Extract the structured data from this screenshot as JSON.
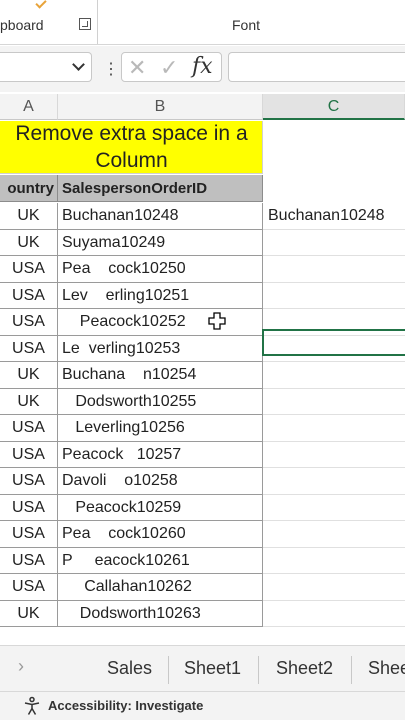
{
  "ribbon": {
    "clipboard_label": "pboard",
    "font_label": "Font"
  },
  "formula_bar": {
    "name_box_value": "",
    "formula_value": ""
  },
  "columns": [
    "A",
    "B",
    "C"
  ],
  "title": {
    "line1": "Remove extra space in a",
    "line2": "Column"
  },
  "table_headers": {
    "country": "ountry",
    "order_id": "SalespersonOrderID"
  },
  "rows": [
    {
      "country": "UK",
      "id": "Buchanan10248",
      "result": "Buchanan10248"
    },
    {
      "country": "UK",
      "id": "Suyama10249",
      "result": ""
    },
    {
      "country": "USA",
      "id": "Pea    cock10250",
      "result": ""
    },
    {
      "country": "USA",
      "id": "Lev    erling10251",
      "result": ""
    },
    {
      "country": "USA",
      "id": "    Peacock10252",
      "result": ""
    },
    {
      "country": "USA",
      "id": "Le  verling10253",
      "result": ""
    },
    {
      "country": "UK",
      "id": "Buchana    n10254",
      "result": ""
    },
    {
      "country": "UK",
      "id": "   Dodsworth10255",
      "result": ""
    },
    {
      "country": "USA",
      "id": "   Leverling10256",
      "result": ""
    },
    {
      "country": "USA",
      "id": "Peacock   10257",
      "result": ""
    },
    {
      "country": "USA",
      "id": "Davoli    o10258",
      "result": ""
    },
    {
      "country": "USA",
      "id": "   Peacock10259",
      "result": ""
    },
    {
      "country": "USA",
      "id": "Pea    cock10260",
      "result": ""
    },
    {
      "country": "USA",
      "id": "P     eacock10261",
      "result": ""
    },
    {
      "country": "USA",
      "id": "     Callahan10262",
      "result": ""
    },
    {
      "country": "UK",
      "id": "    Dodsworth10263",
      "result": ""
    }
  ],
  "sheet_tabs": [
    "Sales",
    "Sheet1",
    "Sheet2",
    "Shee"
  ],
  "status_bar": {
    "accessibility_label": "Accessibility: Investigate"
  },
  "colors": {
    "title_fill": "#ffff00",
    "header_fill": "#bfbfbf",
    "excel_green": "#217346"
  }
}
